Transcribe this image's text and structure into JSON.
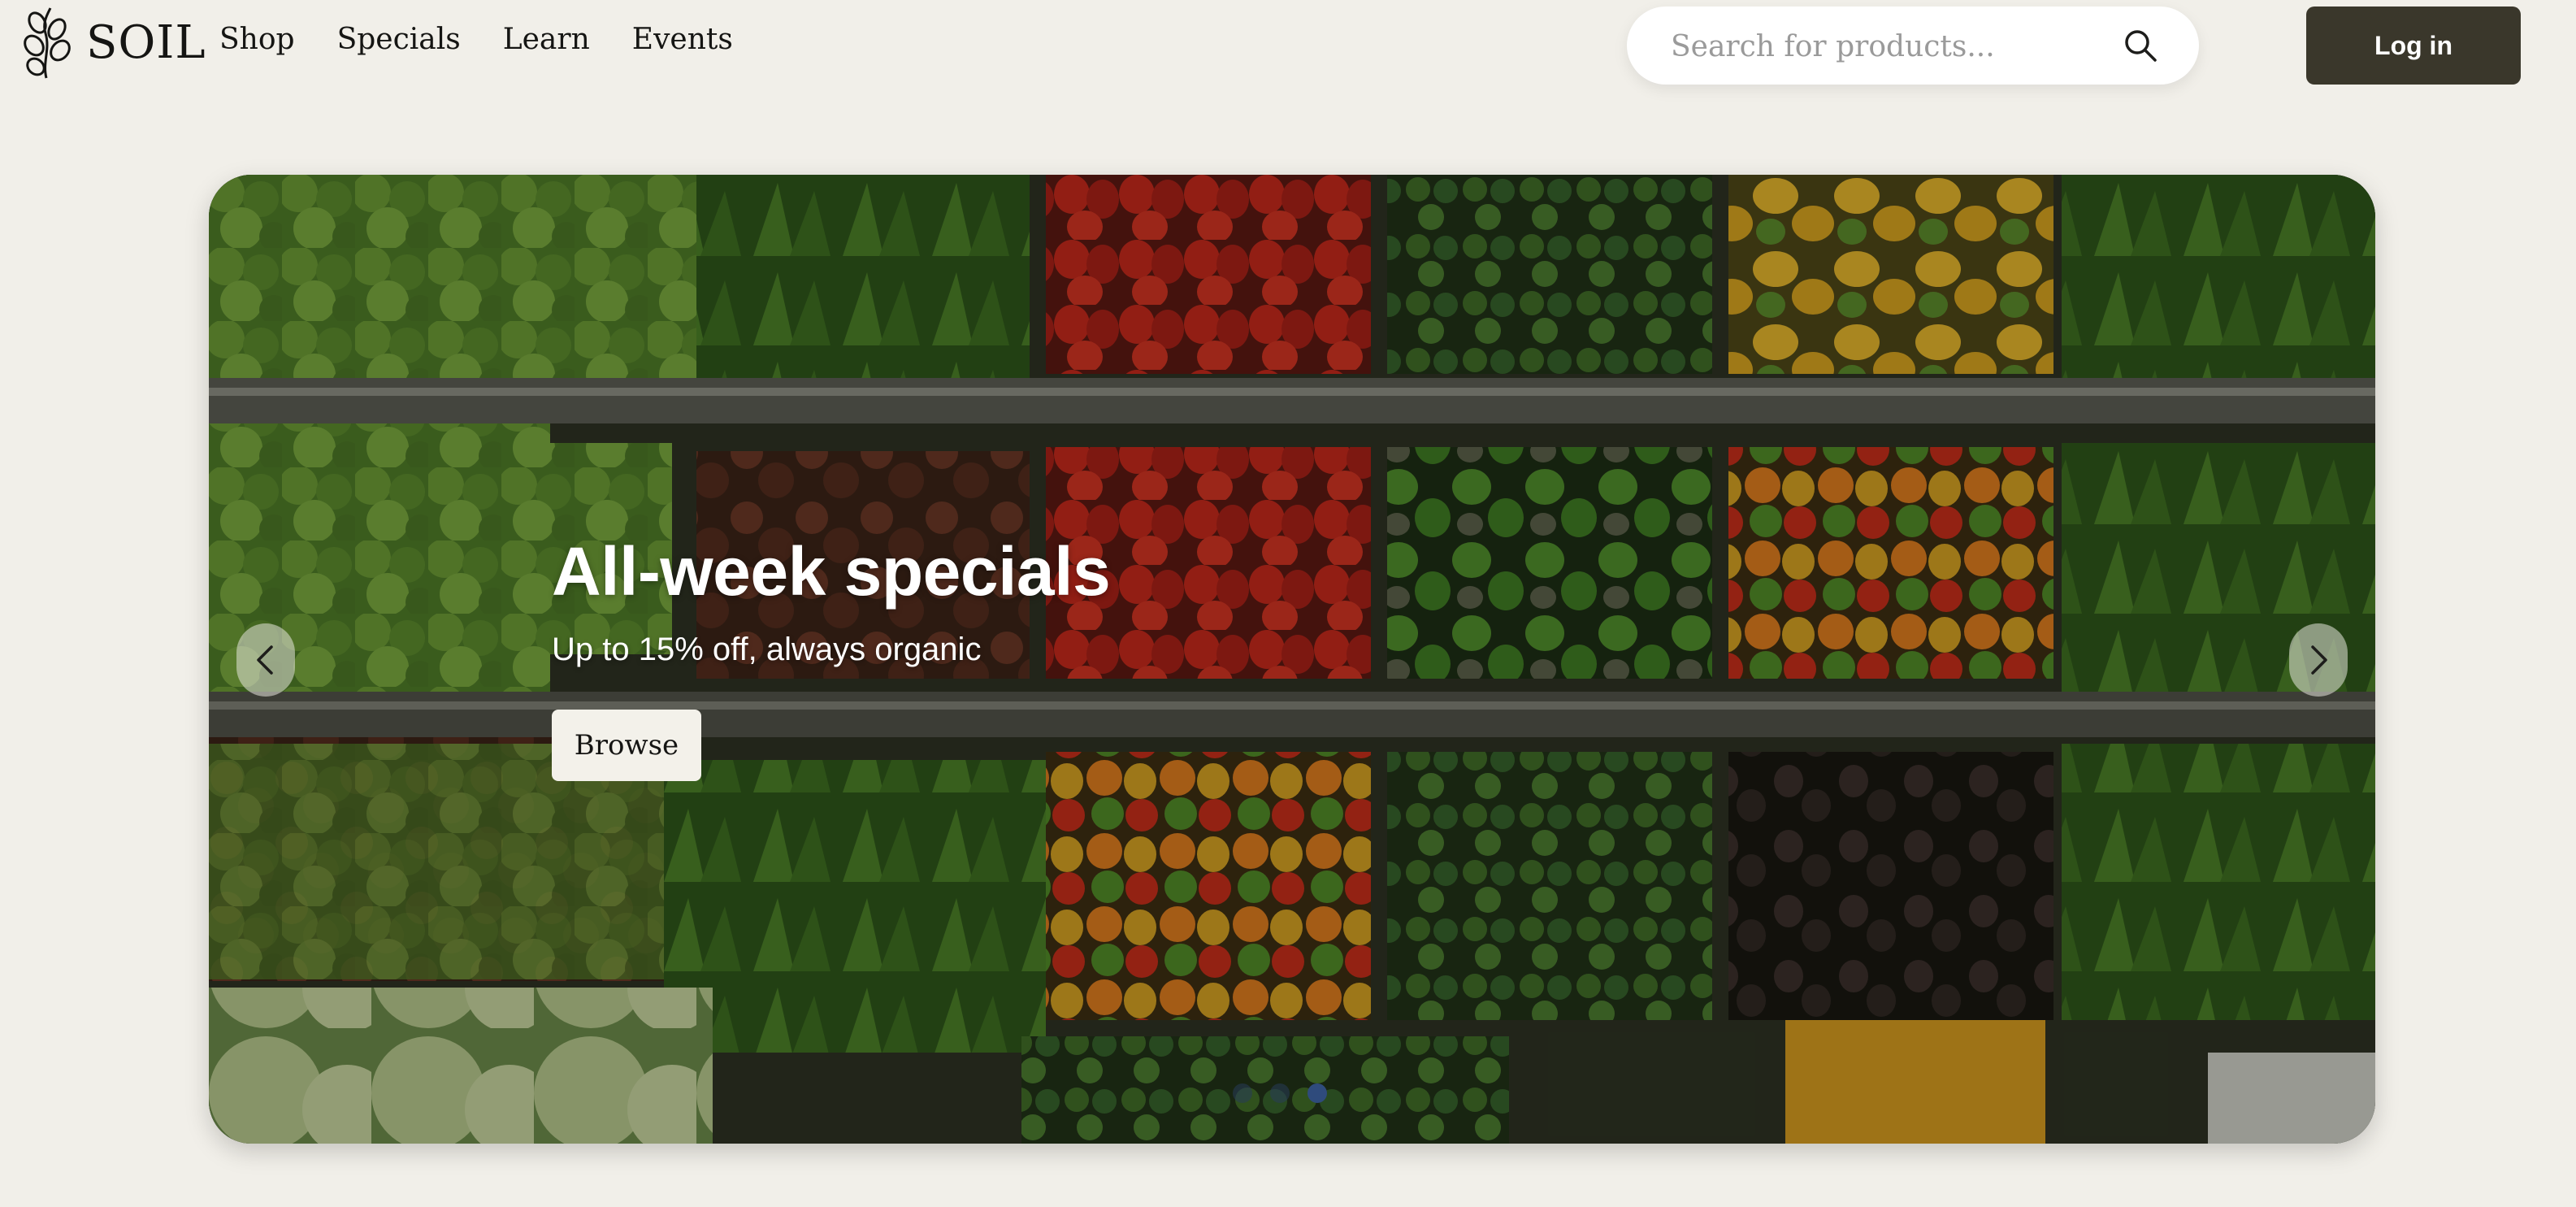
{
  "header": {
    "logo_text": "SOIL",
    "logo_icon": "leaf-vine-icon",
    "nav": [
      {
        "label": "Shop"
      },
      {
        "label": "Specials"
      },
      {
        "label": "Learn"
      },
      {
        "label": "Events"
      }
    ],
    "search": {
      "placeholder": "Search for products...",
      "value": "",
      "icon": "search-icon"
    },
    "login_label": "Log in"
  },
  "hero": {
    "title": "All-week specials",
    "subtitle": "Up to 15% off, always organic",
    "button_label": "Browse",
    "prev_icon": "chevron-left-icon",
    "next_icon": "chevron-right-icon",
    "slides_count": 3,
    "active_slide": 3,
    "image_subject": "vegetable-market-shelves"
  },
  "colors": {
    "background": "#f1efe9",
    "login_button": "#3a372b",
    "active_dot": "#2f4b7c"
  }
}
